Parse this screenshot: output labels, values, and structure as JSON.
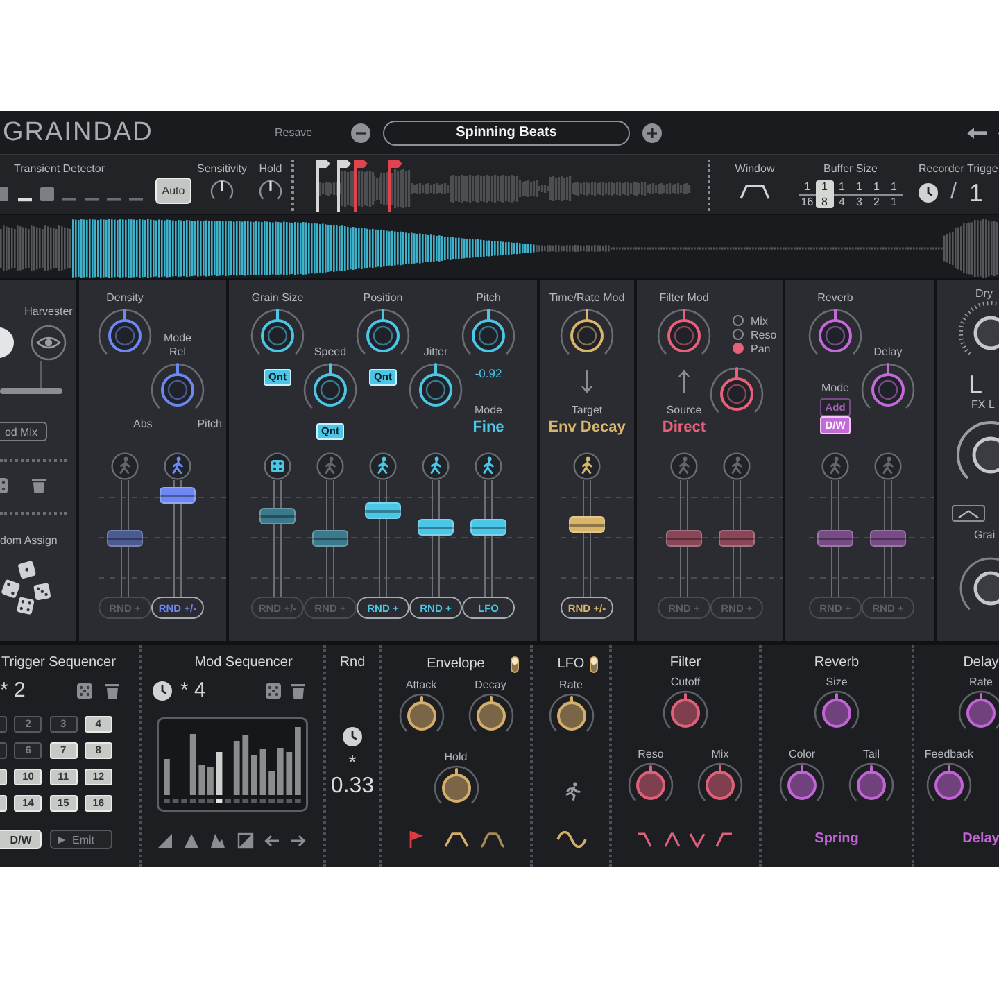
{
  "header": {
    "title": "GRAINDAD",
    "resave": "Resave",
    "preset": "Spinning Beats"
  },
  "transient_detector": {
    "title": "Transient Detector",
    "auto": {
      "label": "Auto",
      "on": true
    },
    "knobs": [
      {
        "label": "Sensitivity"
      },
      {
        "label": "Hold"
      }
    ]
  },
  "sample_markers": [
    {
      "color": "#d6d6d6"
    },
    {
      "color": "#d6d6d6"
    },
    {
      "color": "#e0424e"
    },
    {
      "color": "#e0424e"
    }
  ],
  "window": {
    "label": "Window"
  },
  "buffer_size": {
    "label": "Buffer Size",
    "options": [
      {
        "num": "1",
        "den": "16",
        "selected": false
      },
      {
        "num": "1",
        "den": "8",
        "selected": true
      },
      {
        "num": "1",
        "den": "4",
        "selected": false
      },
      {
        "num": "1",
        "den": "3",
        "selected": false
      },
      {
        "num": "1",
        "den": "2",
        "selected": false
      },
      {
        "num": "1",
        "den": "1",
        "selected": false
      }
    ]
  },
  "recorder_trigger": {
    "label": "Recorder Trigge",
    "slash": "/",
    "value": "1"
  },
  "harvester": {
    "title": "Harvester",
    "mix_button": "od Mix",
    "assign_label": "dom Assign"
  },
  "panels": [
    {
      "kind": "density",
      "color": "#6d88f2",
      "knobs": [
        {
          "label": "Density"
        },
        {
          "label": "Mode",
          "top": "Rel",
          "sides": [
            "Abs",
            "Pitch"
          ]
        }
      ],
      "sliders": [
        {
          "kind": "walk",
          "on": false,
          "level": 0.5,
          "button": "RND +"
        },
        {
          "kind": "walk",
          "on": true,
          "level": 0.93,
          "button": "RND +/-"
        }
      ]
    },
    {
      "kind": "grain",
      "color": "#4cc6e6",
      "knobs": [
        {
          "label": "Grain Size",
          "qnt": {
            "label": "Qnt",
            "on": true
          }
        },
        {
          "label": "Speed",
          "qnt": {
            "label": "Qnt",
            "on": true
          }
        },
        {
          "label": "Position",
          "qnt": {
            "label": "Qnt",
            "on": true
          }
        },
        {
          "label": "Jitter"
        },
        {
          "label": "Pitch",
          "value": "-0.92",
          "mode": {
            "label": "Mode",
            "value": "Fine"
          }
        }
      ],
      "sliders": [
        {
          "kind": "dice",
          "on": false,
          "level": 0.72,
          "button": "RND +/-"
        },
        {
          "kind": "walk",
          "on": false,
          "level": 0.5,
          "button": "RND +"
        },
        {
          "kind": "walk",
          "on": true,
          "level": 0.78,
          "button": "RND +"
        },
        {
          "kind": "walk",
          "on": true,
          "level": 0.61,
          "button": "RND +"
        },
        {
          "kind": "walk",
          "on": true,
          "level": 0.61,
          "button": "LFO"
        }
      ]
    },
    {
      "kind": "time_mod",
      "color": "#d9b56c",
      "knobs": [
        {
          "label": "Time/Rate Mod"
        }
      ],
      "link": {
        "kind": "down",
        "label": "Target",
        "value": "Env Decay"
      },
      "sliders": [
        {
          "kind": "walk",
          "on": true,
          "level": 0.64,
          "button": "RND +/-"
        }
      ]
    },
    {
      "kind": "filter_mod",
      "color": "#e8607a",
      "knobs": [
        {
          "label": "Filter Mod"
        },
        {
          "options": [
            {
              "label": "Mix",
              "selected": false
            },
            {
              "label": "Reso",
              "selected": false
            },
            {
              "label": "Pan",
              "selected": true
            }
          ]
        }
      ],
      "link": {
        "kind": "up",
        "label": "Source",
        "value": "Direct"
      },
      "sliders": [
        {
          "kind": "walk",
          "on": false,
          "level": 0.5,
          "button": "RND +"
        },
        {
          "kind": "walk",
          "on": false,
          "level": 0.5,
          "button": "RND +"
        }
      ]
    },
    {
      "kind": "fx_mod",
      "color": "#c46ad8",
      "knobs": [
        {
          "label": "Reverb"
        },
        {
          "label": "Delay"
        }
      ],
      "mode": {
        "label": "Mode",
        "options": [
          {
            "label": "Add",
            "selected": false
          },
          {
            "label": "D/W",
            "selected": true
          }
        ]
      },
      "sliders": [
        {
          "kind": "walk",
          "on": false,
          "level": 0.5,
          "button": "RND +"
        },
        {
          "kind": "walk",
          "on": false,
          "level": 0.5,
          "button": "RND +"
        }
      ]
    }
  ],
  "output": {
    "dry_label": "Dry",
    "display": "L",
    "fx_label": "FX L",
    "grain_label": "Grai"
  },
  "trigger_sequencer": {
    "title": "Trigger Sequencer",
    "rate": "* 2",
    "steps": [
      {
        "on": false
      },
      {
        "label": "2",
        "on": false
      },
      {
        "label": "3",
        "on": false
      },
      {
        "label": "4",
        "on": true
      },
      {
        "on": false
      },
      {
        "label": "6",
        "on": false
      },
      {
        "label": "7",
        "on": true
      },
      {
        "label": "8",
        "on": true
      },
      {
        "on": true
      },
      {
        "label": "10",
        "on": true
      },
      {
        "label": "11",
        "on": true
      },
      {
        "label": "12",
        "on": true
      },
      {
        "on": true
      },
      {
        "label": "14",
        "on": true
      },
      {
        "label": "15",
        "on": true
      },
      {
        "label": "16",
        "on": true
      }
    ],
    "dw_button": {
      "label": "D/W",
      "on": true
    },
    "emit_button": "Emit"
  },
  "mod_sequencer": {
    "title": "Mod Sequencer",
    "rate": "* 4",
    "steps": [
      {
        "selected": false
      },
      {
        "selected": false
      },
      {
        "selected": false
      },
      {
        "selected": false
      },
      {
        "selected": false
      },
      {
        "selected": false
      },
      {
        "selected": true
      },
      {
        "selected": false
      },
      {
        "selected": false
      },
      {
        "selected": false
      },
      {
        "selected": false
      },
      {
        "selected": false
      },
      {
        "selected": false
      },
      {
        "selected": false
      },
      {
        "selected": false
      },
      {
        "selected": false
      }
    ]
  },
  "rnd": {
    "title": "Rnd",
    "star": "*",
    "value": "0.33"
  },
  "modules": [
    {
      "kind": "envelope",
      "title": "Envelope",
      "color": "#d6ae6b",
      "enabled": true,
      "rows": [
        {
          "knobs": [
            {
              "label": "Attack"
            },
            {
              "label": "Decay"
            }
          ]
        },
        {
          "knobs": [
            {
              "label": "Hold"
            }
          ]
        }
      ]
    },
    {
      "kind": "lfo",
      "title": "LFO",
      "color": "#d6ae6b",
      "enabled": true,
      "rows": [
        {
          "knobs": [
            {
              "label": "Rate"
            }
          ]
        }
      ]
    },
    {
      "kind": "filter",
      "title": "Filter",
      "color": "#e0607a",
      "rows": [
        {
          "knobs": [
            {
              "label": "Cutoff"
            }
          ]
        },
        {
          "knobs": [
            {
              "label": "Reso"
            },
            {
              "label": "Mix"
            }
          ]
        }
      ]
    },
    {
      "kind": "reverb",
      "title": "Reverb",
      "color": "#c264d6",
      "rows": [
        {
          "knobs": [
            {
              "label": "Size"
            }
          ]
        },
        {
          "knobs": [
            {
              "label": "Color"
            },
            {
              "label": "Tail"
            }
          ]
        }
      ],
      "footer": "Spring"
    },
    {
      "kind": "delay",
      "title": "Delay",
      "color": "#c264d6",
      "rows": [
        {
          "knobs": [
            {
              "label": "Rate"
            }
          ]
        },
        {
          "knobs": [
            {
              "label": "Feedback"
            }
          ]
        }
      ],
      "footer": "Delay"
    }
  ]
}
